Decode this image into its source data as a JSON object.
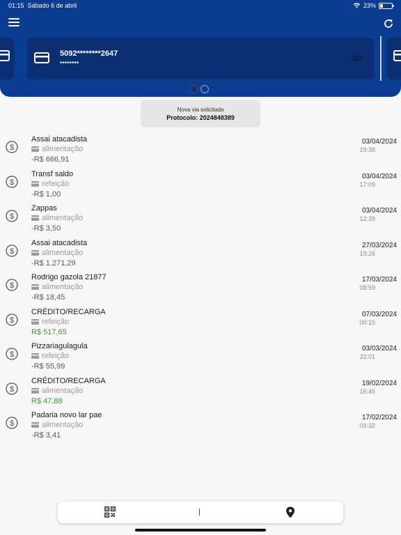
{
  "status_bar": {
    "time": "01:15",
    "date": "Sábado 6 de abril",
    "battery": "23%",
    "battery_level": 0.23
  },
  "colors": {
    "header_bg": "#0a3d91",
    "card_bg": "#0b2f72",
    "credit": "#3c9a3c",
    "debit": "#5a5a5a"
  },
  "header": {
    "menu_icon": "hamburger-menu-icon",
    "refresh_icon": "refresh-icon",
    "card": {
      "number": "5092********2647",
      "masked_balance": "********",
      "icon": "credit-card-icon",
      "toggle_icon": "eye-icon"
    },
    "pager": {
      "pages": 2,
      "active_index": 0
    }
  },
  "notice": {
    "line1": "Nova via solicitada",
    "line2": "Protocolo: 2024848389"
  },
  "transactions": [
    {
      "name": "Assai atacadista",
      "category": "alimentação",
      "amount": "-R$ 666,91",
      "type": "debit",
      "date": "03/04/2024",
      "time": "19:38"
    },
    {
      "name": "Transf saldo",
      "category": "refeição",
      "amount": "-R$ 1,00",
      "type": "debit",
      "date": "03/04/2024",
      "time": "17:09"
    },
    {
      "name": "Zappas",
      "category": "alimentação",
      "amount": "-R$ 3,50",
      "type": "debit",
      "date": "03/04/2024",
      "time": "12:39"
    },
    {
      "name": "Assai atacadista",
      "category": "alimentação",
      "amount": "-R$ 1.271,29",
      "type": "debit",
      "date": "27/03/2024",
      "time": "19:26"
    },
    {
      "name": "Rodrigo gazola 21877",
      "category": "alimentação",
      "amount": "-R$ 18,45",
      "type": "debit",
      "date": "17/03/2024",
      "time": "08:59"
    },
    {
      "name": "CRÉDITO/RECARGA",
      "category": "refeição",
      "amount": "R$ 517,65",
      "type": "credit",
      "date": "07/03/2024",
      "time": "00:15"
    },
    {
      "name": "Pizzariagulagula",
      "category": "refeição",
      "amount": "-R$ 55,99",
      "type": "debit",
      "date": "03/03/2024",
      "time": "22:01"
    },
    {
      "name": "CRÉDITO/RECARGA",
      "category": "alimentação",
      "amount": "R$ 47,88",
      "type": "credit",
      "date": "19/02/2024",
      "time": "16:45"
    },
    {
      "name": "Padaria novo lar pae",
      "category": "alimentação",
      "amount": "-R$ 3,41",
      "type": "debit",
      "date": "17/02/2024",
      "time": "09:32"
    }
  ],
  "bottom_nav": {
    "separator": "|",
    "items": [
      {
        "icon": "qr-code-icon"
      },
      {
        "icon": "location-pin-icon"
      }
    ]
  }
}
